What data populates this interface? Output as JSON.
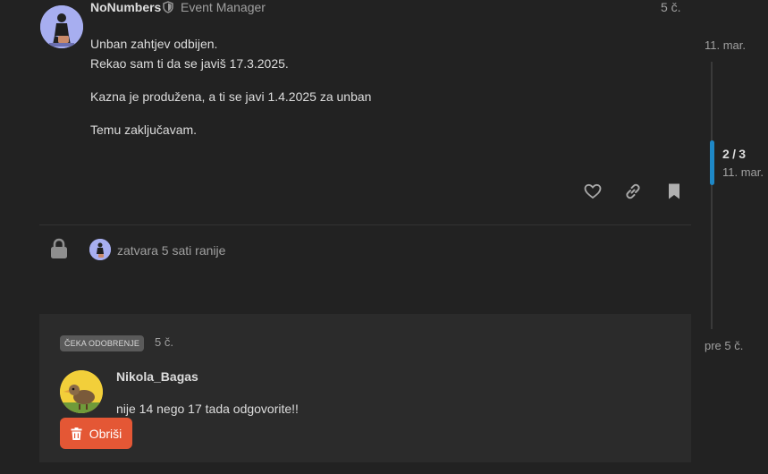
{
  "post": {
    "username": "NoNumbers",
    "user_title": "Event Manager",
    "age": "5 č.",
    "lines": [
      "Unban zahtjev odbijen.",
      "Rekao sam ti da se javiš 17.3.2025.",
      "Kazna je produžena, a ti se javi 1.4.2025 za unban",
      "Temu zaključavam."
    ]
  },
  "small_action": {
    "text": "zatvara 5 sati ranije"
  },
  "pending": {
    "badge": "ČEKA ODOBRENJE",
    "age": "5 č.",
    "username": "Nikola_Bagas",
    "text": "nije 14 nego 17 tada odgovorite!!",
    "delete_label": "Obriši"
  },
  "timeline": {
    "start_date": "11. mar.",
    "position": "2 / 3",
    "current_date": "11. mar.",
    "end_label": "pre 5 č."
  },
  "colors": {
    "accent": "#1e88c7",
    "danger": "#e45735",
    "background": "#222222"
  }
}
